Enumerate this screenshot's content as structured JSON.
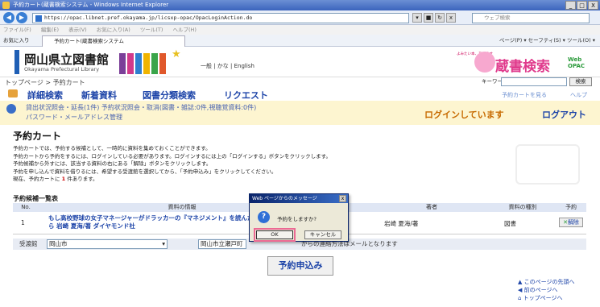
{
  "window": {
    "title": "予約カート(蔵書検索システム - Windows Internet Explorer",
    "min": "_",
    "max": "□",
    "close": "X"
  },
  "browser": {
    "url": "https://opac.libnet.pref.okayama.jp/licsxp-opac/OpacLoginAction.do",
    "search_placeholder": "ウェブ検索",
    "menu": [
      "ファイル(F)",
      "編集(E)",
      "表示(V)",
      "お気に入り(A)",
      "ツール(T)",
      "ヘルプ(H)"
    ],
    "favorites": "お気に入り",
    "tab_title": "予約カート(蔵書検索システム",
    "tools": "ページ(P) ▾  セーフティ(S) ▾  ツール(O) ▾"
  },
  "header": {
    "library_name": "岡山県立図書館",
    "library_name_en": "Okayama Prefectural Library",
    "langs": "一般 | かな | English",
    "opac_tagline": "よみたい本、あります",
    "opac_title": "蔵書検索",
    "opac_badge": "Web OPAC"
  },
  "breadcrumb": "トップページ > 予約カート",
  "keyword": {
    "label": "キーワード",
    "button": "検索"
  },
  "nav": {
    "items": [
      "詳細検索",
      "新着資料",
      "図書分類検索",
      "リクエスト"
    ],
    "cart_link": "予約カートを見る",
    "help": "ヘルプ"
  },
  "info": {
    "line1": "貸出状況照会・延長(1件)   予約状況照会・取消(図書・雑誌:0件,視聴覚資料:0件)",
    "line2": "パスワード・メールアドレス管理",
    "login_status": "ログインしています",
    "logout": "ログアウト"
  },
  "main": {
    "title": "予約カート",
    "desc1": "予約カートでは、予約する候補として、一時的に資料を集めておくことができます。",
    "desc2": "予約カートから予約をするには、ログインしている必要があります。ログインするには上の「ログインする」ボタンをクリックします。",
    "desc3": "予約候補から外すには、該当する資料の右にある「解除」ボタンをクリックします。",
    "desc4": "予約を申し込んで資料を借りるには、希望する受渡館を選択してから、「予約申込み」をクリックしてください。",
    "count_prefix": "現在、予約カートに",
    "count": "1",
    "count_suffix": "件あります。",
    "list_title": "予約候補一覧表"
  },
  "table": {
    "headers": [
      "No.",
      "資料の情報",
      "著者",
      "資料の種別",
      "予約"
    ],
    "rows": [
      {
        "no": "1",
        "title": "もし高校野球の女子マネージャーがドラッカーの『マネジメント』を読んだら 岩崎 夏海/著 ダイヤモンド社",
        "author": "岩崎 夏海/著",
        "kind": "図書",
        "action": "解除"
      }
    ]
  },
  "pickup": {
    "label": "受渡館",
    "library": "岡山市",
    "branch": "岡山市立瀬戸町",
    "note": "からの連絡方法はメールとなります"
  },
  "reserve_button": "予約申込み",
  "footer": [
    "このページの先頭へ",
    "前のページへ",
    "トップページへ"
  ],
  "dialog": {
    "title": "Web ページからのメッセージ",
    "message": "予約をしますか?",
    "ok": "OK",
    "cancel": "キャンセル"
  }
}
